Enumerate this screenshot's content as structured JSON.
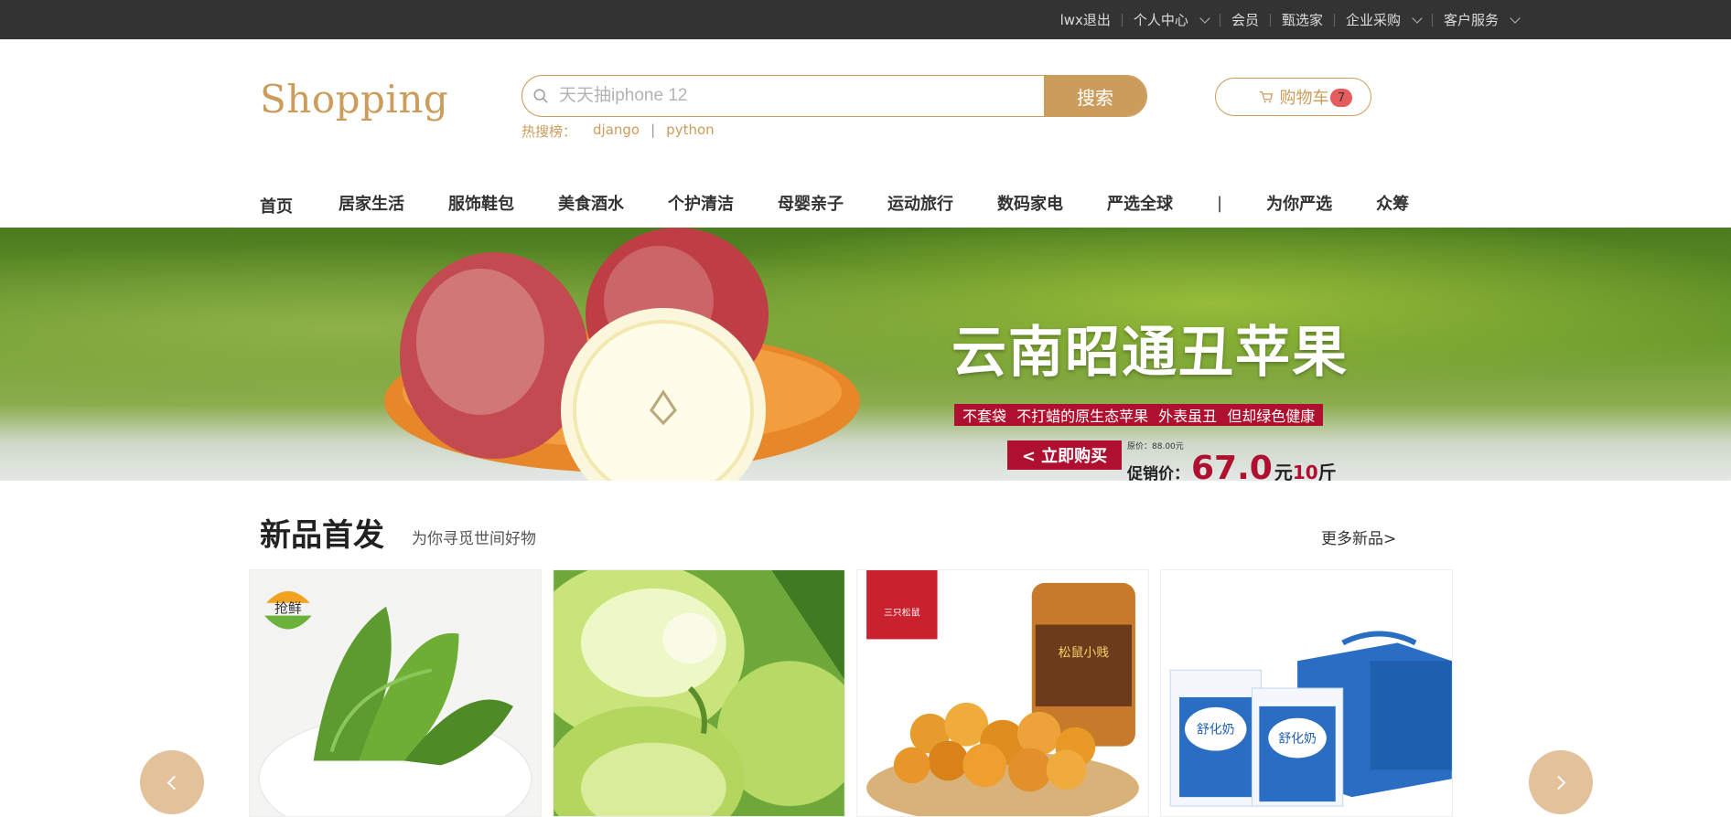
{
  "topbar": {
    "links": [
      {
        "label": "lwx退出",
        "dropdown": false
      },
      {
        "label": "个人中心",
        "dropdown": true
      },
      {
        "label": "会员",
        "dropdown": false
      },
      {
        "label": "甄选家",
        "dropdown": false
      },
      {
        "label": "企业采购",
        "dropdown": true
      },
      {
        "label": "客户服务",
        "dropdown": true
      }
    ]
  },
  "header": {
    "logo": "Shopping",
    "search": {
      "placeholder": "天天抽iphone 12",
      "button": "搜索"
    },
    "hot": {
      "label": "热搜榜：",
      "keywords": [
        "django",
        "python"
      ],
      "separator": "|"
    },
    "cart": {
      "label": "购物车",
      "count": "7"
    }
  },
  "nav": {
    "items": [
      "首页",
      "居家生活",
      "服饰鞋包",
      "美食酒水",
      "个护清洁",
      "母婴亲子",
      "运动旅行",
      "数码家电",
      "严选全球",
      "|",
      "为你严选",
      "众筹"
    ]
  },
  "banner": {
    "title": "云南昭通丑苹果",
    "subtitle": "不套袋 不打蜡的原生态苹果 外表虽丑 但却绿色健康",
    "buy_button": "< 立即购买",
    "original_price": "原价：88.00元",
    "promo_label": "促销价：",
    "promo_price": "67.0",
    "promo_unit": "元",
    "promo_weight": "10",
    "promo_weight_unit": "斤"
  },
  "section": {
    "title": "新品首发",
    "subtitle": "为你寻觅世间好物",
    "more": "更多新品>"
  },
  "products": [
    {
      "name": "vegetable-product",
      "brand_text": "抢鲜"
    },
    {
      "name": "guava-product"
    },
    {
      "name": "popcorn-product",
      "brand_text": "三只松鼠",
      "jar_text": "松鼠小贱"
    },
    {
      "name": "milk-product",
      "box_text": "舒化奶"
    }
  ],
  "colors": {
    "accent": "#cb9c5c",
    "topbar": "#333333",
    "banner_red": "#b0102f",
    "badge": "#e65b5b"
  }
}
